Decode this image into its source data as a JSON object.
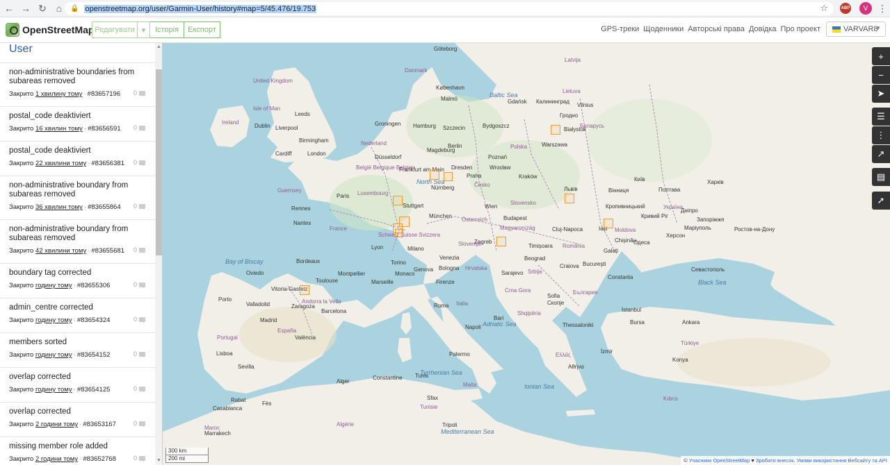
{
  "browser": {
    "url": "openstreetmap.org/user/Garmin-User/history#map=5/45.476/19.753",
    "ext_label": "ABP",
    "profile_initial": "V"
  },
  "header": {
    "logo_text": "OpenStreetMap",
    "edit_label": "Редагувати",
    "history_label": "Історія",
    "export_label": "Експорт",
    "links": [
      "GPS-треки",
      "Щоденники",
      "Авторські права",
      "Довідка",
      "Про проект"
    ],
    "user_name": "VARVAR8"
  },
  "sidebar": {
    "title": "User",
    "changesets": [
      {
        "comment": "non-administrative boundaries from subareas removed",
        "status": "Закрито",
        "time": "1 хвилину тому",
        "id": "#83657196",
        "comments": "0"
      },
      {
        "comment": "postal_code deaktiviert",
        "status": "Закрито",
        "time": "16 хвилин тому",
        "id": "#83656591",
        "comments": "0"
      },
      {
        "comment": "postal_code deaktiviert",
        "status": "Закрито",
        "time": "22 хвилини тому",
        "id": "#83656381",
        "comments": "0"
      },
      {
        "comment": "non-administrative boundary from subareas removed",
        "status": "Закрито",
        "time": "36 хвилин тому",
        "id": "#83655864",
        "comments": "0"
      },
      {
        "comment": "non-administrative boundary from subareas removed",
        "status": "Закрито",
        "time": "42 хвилини тому",
        "id": "#83655681",
        "comments": "0"
      },
      {
        "comment": "boundary tag corrected",
        "status": "Закрито",
        "time": "годину тому",
        "id": "#83655306",
        "comments": "0"
      },
      {
        "comment": "admin_centre corrected",
        "status": "Закрито",
        "time": "годину тому",
        "id": "#83654324",
        "comments": "0"
      },
      {
        "comment": "members sorted",
        "status": "Закрито",
        "time": "годину тому",
        "id": "#83654152",
        "comments": "0"
      },
      {
        "comment": "overlap corrected",
        "status": "Закрито",
        "time": "годину тому",
        "id": "#83654125",
        "comments": "0"
      },
      {
        "comment": "overlap corrected",
        "status": "Закрито",
        "time": "2 години тому",
        "id": "#83653167",
        "comments": "0"
      },
      {
        "comment": "missing member role added",
        "status": "Закрито",
        "time": "2 години тому",
        "id": "#83652768",
        "comments": "0"
      }
    ]
  },
  "map": {
    "labels": {
      "seas": [
        "North Sea",
        "Baltic Sea",
        "Black Sea",
        "Mediterranean Sea",
        "Adriatic Sea",
        "Tyrrhenian Sea",
        "Ionian Sea",
        "Bay of Biscay"
      ],
      "countries": [
        "United Kingdom",
        "Ireland",
        "Isle of Man",
        "Danmark",
        "Nederland",
        "België Belgique Belgien",
        "Luxembourg",
        "France",
        "Schweiz Suisse Svizzera",
        "Österreich",
        "Česko",
        "Polska",
        "Slovensko",
        "Magyarország",
        "România",
        "Україна",
        "Moldova",
        "Беларусь",
        "Lietuva",
        "Latvija",
        "Slovenija",
        "Hrvatska",
        "Italia",
        "España",
        "Portugal",
        "Srbija",
        "Crna Gora",
        "Shqipëria",
        "България",
        "Ελλάς",
        "Türkiye",
        "Kıbrıs",
        "Algérie",
        "Tunisie",
        "Maroc",
        "Malta",
        "Andorra la Vella",
        "Guernsey"
      ],
      "cities": [
        "Leeds",
        "Liverpool",
        "Birmingham",
        "London",
        "Dublin",
        "Cardiff",
        "Groningen",
        "Hamburg",
        "Szczecin",
        "Bydgoszcz",
        "Gdańsk",
        "Калининград",
        "København",
        "Malmö",
        "Göteborg",
        "Berlin",
        "Poznań",
        "Warszawa",
        "Białystok",
        "Гродно",
        "Vilnius",
        "Düsseldorf",
        "Magdeburg",
        "Dresden",
        "Wrocław",
        "Kraków",
        "Frankfurt am Main",
        "Nürnberg",
        "Stuttgart",
        "München",
        "Wien",
        "Praha",
        "Paris",
        "Rennes",
        "Nantes",
        "Lyon",
        "Milano",
        "Torino",
        "Genova",
        "Monaco",
        "Marseille",
        "Bologna",
        "Venezia",
        "Firenze",
        "Roma",
        "Napoli",
        "Bari",
        "Palermo",
        "Zagreb",
        "Sarajevo",
        "Beograd",
        "Budapest",
        "Cluj-Napoca",
        "Timișoara",
        "Bucureşti",
        "Craiova",
        "Constanta",
        "Одеса",
        "Херсон",
        "Севастополь",
        "Київ",
        "Львів",
        "Вінниця",
        "Полтава",
        "Харків",
        "Дніпро",
        "Запоріжжя",
        "Кропивницький",
        "Кривий Ріг",
        "Маріуполь",
        "Ростов-на-Дону",
        "Chișinău",
        "Galați",
        "Iași",
        "Sofia",
        "Скопје",
        "Thessaloniki",
        "Αθήνα",
        "İstanbul",
        "Ankara",
        "İzmir",
        "Bursa",
        "Konya",
        "Lisboa",
        "Porto",
        "Madrid",
        "Sevilla",
        "València",
        "Barcelona",
        "Zaragoza",
        "Valladolid",
        "Vitoria-Gasteiz",
        "Oviedo",
        "Bordeaux",
        "Toulouse",
        "Montpellier",
        "Alger",
        "Tunis",
        "Rabat",
        "Casablanca",
        "Fès",
        "Marrakech",
        "Constantine",
        "Sfax",
        "Tripoli"
      ]
    },
    "scale": [
      "300 km",
      "200 mi"
    ],
    "attribution": {
      "prefix": "© ",
      "contributors": "Учасники OpenStreetMap",
      "heart": "♥",
      "donate": "Зробити внесок",
      "terms": "Умови використання Вебсайту та API"
    },
    "controls": [
      "zoom-in",
      "locate",
      "layers",
      "share",
      "notes",
      "query"
    ]
  }
}
